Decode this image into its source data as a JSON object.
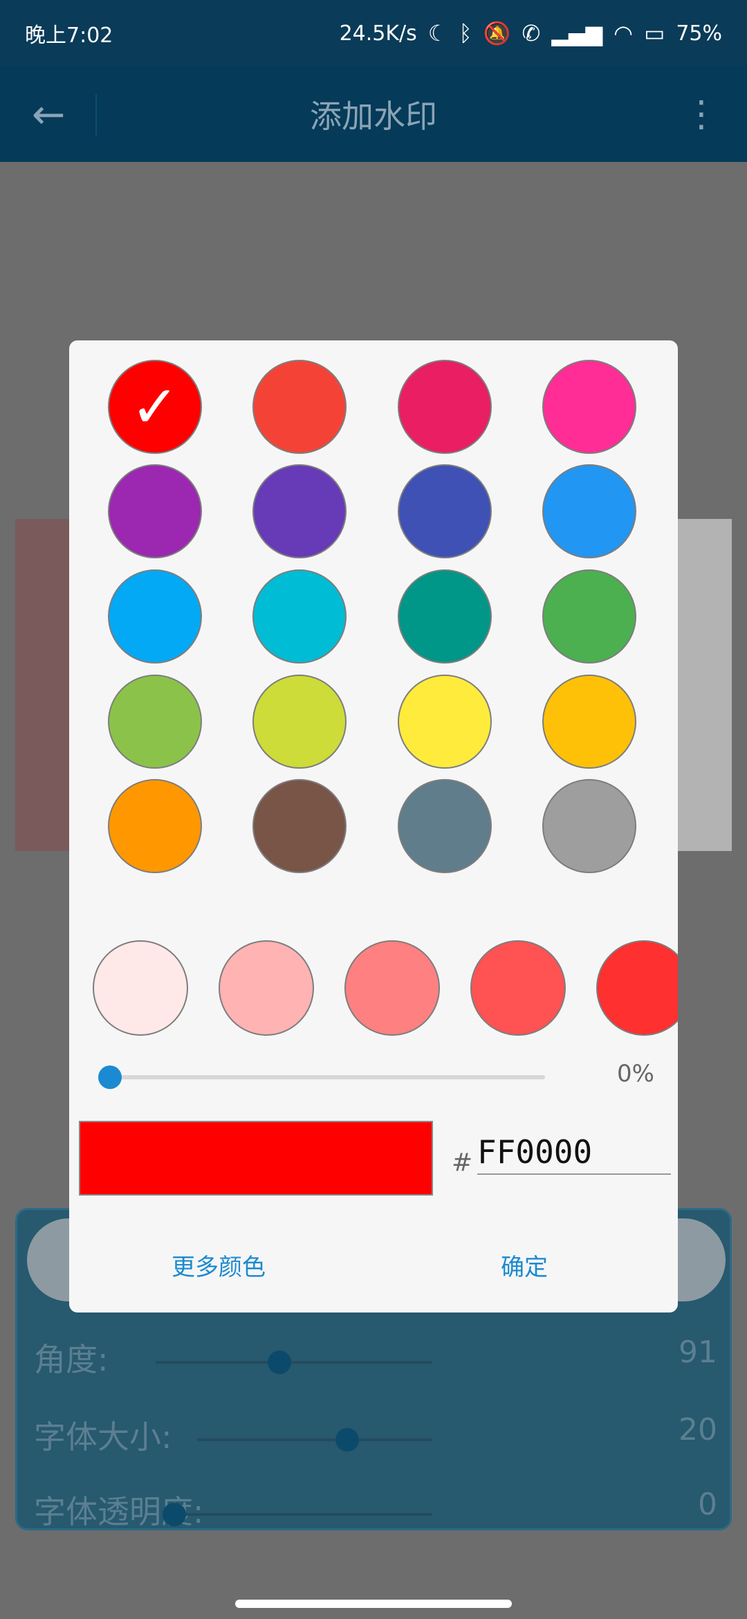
{
  "status_bar": {
    "time": "晚上7:02",
    "network_speed": "24.5K/s",
    "battery": "75%",
    "icons": [
      "moon-icon",
      "bluetooth-icon",
      "mute-bell-icon",
      "call-icon",
      "signal-icon",
      "wifi-icon",
      "battery-icon"
    ]
  },
  "appbar": {
    "title": "添加水印",
    "back_icon": "arrow-left-icon",
    "more_icon": "more-vertical-icon"
  },
  "panel": {
    "rows": [
      {
        "label": "角度:",
        "value": "91"
      },
      {
        "label": "字体大小:",
        "value": "20"
      },
      {
        "label": "字体透明度:",
        "value": "0"
      }
    ]
  },
  "dialog": {
    "palette": [
      [
        "#FF0000",
        "#F44336",
        "#E91E63",
        "#FF2D95"
      ],
      [
        "#9C27B0",
        "#673AB7",
        "#3F51B5",
        "#2196F3"
      ],
      [
        "#03A9F4",
        "#00BCD4",
        "#009688",
        "#4CAF50"
      ],
      [
        "#8BC34A",
        "#CDDC39",
        "#FFEB3B",
        "#FFC107"
      ],
      [
        "#FF9800",
        "#795548",
        "#607D8B",
        "#9E9E9E"
      ]
    ],
    "selected_color": "#FF0000",
    "shades": [
      "#FFE8E8",
      "#FFB3B3",
      "#FF8080",
      "#FF5252",
      "#FF3030"
    ],
    "opacity_slider": {
      "value": "0%"
    },
    "hex_prefix": "#",
    "hex_value": "FF0000",
    "buttons": {
      "more_colors": "更多颜色",
      "confirm": "确定"
    }
  }
}
